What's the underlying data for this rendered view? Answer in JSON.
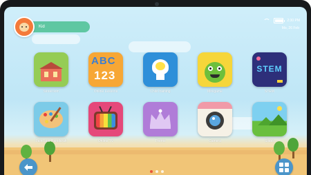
{
  "user": {
    "name": "Kid"
  },
  "status": {
    "time": "2:30 PM",
    "date": "Mo, 26 Feb",
    "battery_level": 0.85
  },
  "apps": [
    {
      "label": "Storeroom"
    },
    {
      "label": "Online Lessons"
    },
    {
      "label": "Child training"
    },
    {
      "label": "Minigame"
    },
    {
      "label": "STEM"
    },
    {
      "label": "Paint and Handicraft"
    },
    {
      "label": "Online TV"
    },
    {
      "label": "Theme"
    },
    {
      "label": "Camera"
    },
    {
      "label": "Slides"
    }
  ],
  "tile_texts": {
    "abc": "ABC",
    "num": "123",
    "stem": "STEM"
  },
  "icons": {
    "back": "arrow-left-icon",
    "apps": "grid-icon"
  },
  "colors": {
    "sky": "#cfeefa",
    "ground": "#f1c577",
    "nav_button": "#4b95c9",
    "name_pill": "#5fc7a2"
  }
}
